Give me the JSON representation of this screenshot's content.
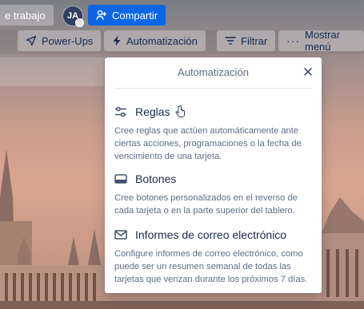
{
  "topbar": {
    "workspace_label": "e trabajo",
    "avatar_initials": "JA",
    "share_label": "Compartir"
  },
  "board_header": {
    "powerups_label": "Power-Ups",
    "automation_label": "Automatización",
    "filter_label": "Filtrar",
    "more_label": "Mostrar menú"
  },
  "popover": {
    "title": "Automatización",
    "items": [
      {
        "title": "Reglas",
        "icon": "sliders-icon",
        "description": "Cree reglas que actúen automáticamente ante ciertas acciones, programaciones o la fecha de vencimiento de una tarjeta."
      },
      {
        "title": "Botones",
        "icon": "button-icon",
        "description": "Cree botones personalizados en el reverso de cada tarjeta o en la parte superior del tablero."
      },
      {
        "title": "Informes de correo electrónico",
        "icon": "mail-icon",
        "description": "Configure informes de correo electrónico, como puede ser un resumen semanal de todas las tarjetas que venzan durante los próximos 7 días."
      }
    ]
  },
  "colors": {
    "share_blue": "#0c66e4",
    "text_primary": "#172b4d",
    "text_secondary": "#5e6c84"
  }
}
